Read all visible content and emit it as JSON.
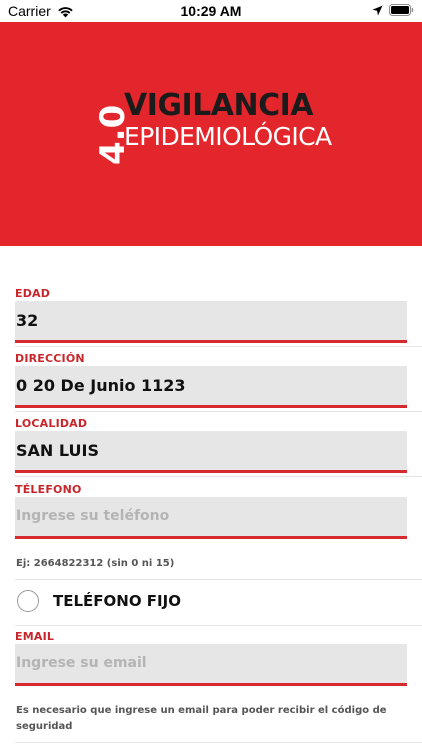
{
  "status_bar": {
    "carrier": "Carrier",
    "time": "10:29 AM"
  },
  "header": {
    "logo_number": "4.0",
    "logo_line1": "VIGILANCIA",
    "logo_line2": "EPIDEMIOLÓGICA",
    "background_color": "#e3262c"
  },
  "form": {
    "accent_color": "#d62a2e",
    "edad": {
      "label": "EDAD",
      "value": "32"
    },
    "direccion": {
      "label": "DIRECCIÓN",
      "value": "0 20 De Junio 1123"
    },
    "localidad": {
      "label": "LOCALIDAD",
      "value": "SAN LUIS"
    },
    "telefono": {
      "label": "TÉLEFONO",
      "placeholder": "Ingrese su teléfono",
      "hint": "Ej: 2664822312 (sin 0 ni 15)"
    },
    "telefono_fijo": {
      "label": "TELÉFONO FIJO",
      "checked": false
    },
    "email": {
      "label": "EMAIL",
      "placeholder": "Ingrese su email",
      "hint": "Es necesario que ingrese un email para poder recibir el código de seguridad"
    }
  }
}
